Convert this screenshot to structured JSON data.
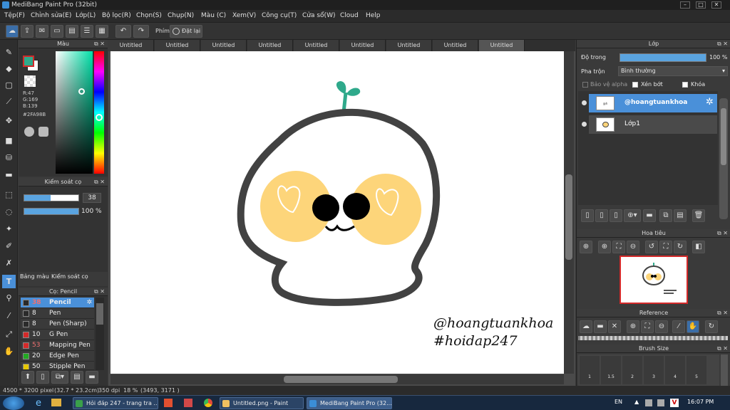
{
  "window": {
    "title": "MediBang Paint Pro (32bit)",
    "controls": [
      "–",
      "□",
      "✕"
    ]
  },
  "menu": [
    "Tệp(F)",
    "Chỉnh sửa(E)",
    "Lớp(L)",
    "Bộ lọc(R)",
    "Chọn(S)",
    "Chụp(N)",
    "Màu (C)",
    "Xem(V)",
    "Công cụ(T)",
    "Cửa sổ(W)",
    "Cloud",
    "Help"
  ],
  "toolbar": {
    "shortcut_label": "Phím",
    "reset_label": "Đặt lại"
  },
  "color_panel": {
    "title": "Màu",
    "r": "R:47",
    "g": "G:169",
    "b": "B:139",
    "hex": "#2FA98B",
    "current_color": "#2fa98b"
  },
  "brush_control": {
    "title": "Kiểm soát cọ",
    "size": "38",
    "opacity": "100 %",
    "size_fraction": 0.38,
    "opacity_fraction": 1.0
  },
  "left_tabs": [
    "Bảng màu",
    "Kiểm soát cọ"
  ],
  "brush_panel": {
    "title": "Cọ: Pencil",
    "items": [
      {
        "size": "38",
        "name": "Pencil",
        "color": "#2a2a2a",
        "selected": true
      },
      {
        "size": "8",
        "name": "Pen",
        "color": "#2a2a2a"
      },
      {
        "size": "8",
        "name": "Pen (Sharp)",
        "color": "#2a2a2a"
      },
      {
        "size": "10",
        "name": "G Pen",
        "color": "#d42a2a"
      },
      {
        "size": "53",
        "name": "Mapping Pen",
        "color": "#d42a2a"
      },
      {
        "size": "20",
        "name": "Edge Pen",
        "color": "#22aa22"
      },
      {
        "size": "50",
        "name": "Stipple Pen",
        "color": "#e6c800"
      }
    ]
  },
  "canvas_tabs": [
    "Untitled",
    "Untitled",
    "Untitled",
    "Untitled",
    "Untitled",
    "Untitled",
    "Untitled",
    "Untitled",
    "Untitled"
  ],
  "canvas": {
    "watermark_line1": "@hoangtuankhoa",
    "watermark_line2": "#hoidap247"
  },
  "layer_panel": {
    "title": "Lớp",
    "opacity_label": "Độ trong",
    "opacity_value": "100 %",
    "blend_label": "Pha trộn",
    "blend_value": "Bình thường",
    "protect_alpha": "Bảo vệ alpha",
    "clip": "Xén bớt",
    "lock": "Khóa",
    "layers": [
      {
        "name": "@hoangtuankhoa",
        "selected": true
      },
      {
        "name": "Lớp1",
        "selected": false
      }
    ]
  },
  "navigator": {
    "title": "Hoa tiêu"
  },
  "reference": {
    "title": "Reference"
  },
  "brush_size": {
    "title": "Brush Size",
    "sizes": [
      "1",
      "1.5",
      "2",
      "3",
      "4",
      "5"
    ]
  },
  "status_bar": {
    "dimensions": "4500 * 3200 pixel",
    "cm": "(32.7 * 23.2cm)",
    "dpi": "350 dpi",
    "zoom": "18 %",
    "coords": "(3493, 3171 )"
  },
  "taskbar": {
    "items": [
      "Hỏi đáp 247 - trang tra ...",
      "Untitled.png - Paint",
      "MediBang Paint Pro (32..."
    ],
    "lang": "EN",
    "time": "16:07 PM"
  }
}
